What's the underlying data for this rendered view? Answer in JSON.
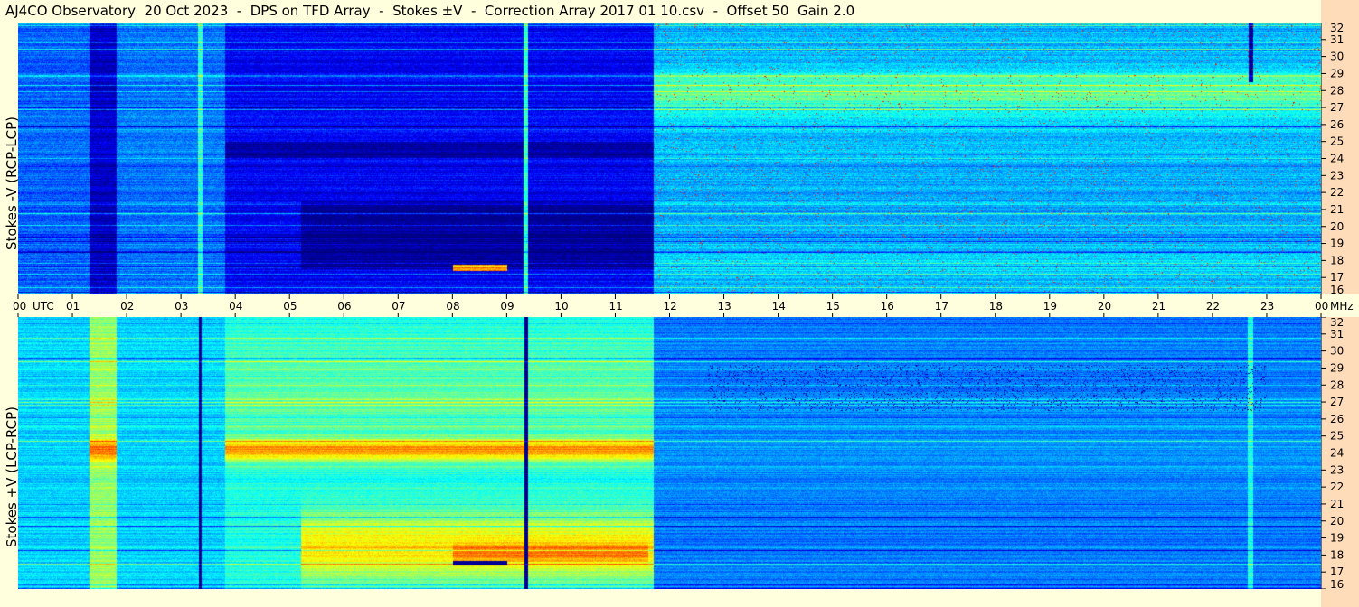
{
  "title": "AJ4CO Observatory  20 Oct 2023  -  DPS on TFD Array  -  Stokes ±V  -  Correction Array 2017 01 10.csv  -  Offset 50  Gain 2.0",
  "chart_data": [
    {
      "type": "heatmap",
      "panel": "top",
      "ylabel": "Stokes -V (RCP-LCP)",
      "xlabel": "UTC",
      "x_ticks": [
        "00",
        "01",
        "02",
        "03",
        "04",
        "05",
        "06",
        "07",
        "08",
        "09",
        "10",
        "11",
        "12",
        "13",
        "14",
        "15",
        "16",
        "17",
        "18",
        "19",
        "20",
        "21",
        "22",
        "23",
        "00"
      ],
      "y_unit": "MHz",
      "y_ticks": [
        16,
        17,
        18,
        19,
        20,
        21,
        22,
        23,
        24,
        25,
        26,
        27,
        28,
        29,
        30,
        31,
        32
      ],
      "xlim_hours": [
        0,
        24
      ],
      "ylim_mhz": [
        16,
        32
      ],
      "colormap": "jet",
      "features": [
        {
          "desc": "low-intensity dark band",
          "start_hour": 1.3,
          "end_hour": 1.8
        },
        {
          "desc": "low-intensity dark band",
          "start_hour": 3.8,
          "end_hour": 11.7
        },
        {
          "desc": "narrow vertical spike",
          "hour": 3.35
        },
        {
          "desc": "narrow vertical spike",
          "hour": 9.35
        },
        {
          "desc": "elevated activity 27-29 MHz",
          "start_hour": 12.7,
          "end_hour": 23.0
        },
        {
          "desc": "narrow dark vertical line",
          "hour": 22.7
        }
      ]
    },
    {
      "type": "heatmap",
      "panel": "bottom",
      "ylabel": "Stokes +V (LCP-RCP)",
      "xlabel": "UTC",
      "y_unit": "MHz",
      "y_ticks": [
        16,
        17,
        18,
        19,
        20,
        21,
        22,
        23,
        24,
        25,
        26,
        27,
        28,
        29,
        30,
        31,
        32
      ],
      "xlim_hours": [
        0,
        24
      ],
      "ylim_mhz": [
        16,
        32
      ],
      "colormap": "jet",
      "features": [
        {
          "desc": "bright band centered 24.3 MHz",
          "start_hour": 1.3,
          "end_hour": 1.8
        },
        {
          "desc": "bright band centered 24.3 MHz",
          "start_hour": 3.8,
          "end_hour": 11.7
        },
        {
          "desc": "bright band centered 18 MHz",
          "start_hour": 5.2,
          "end_hour": 11.7
        },
        {
          "desc": "dark vertical line",
          "hour": 3.35
        },
        {
          "desc": "dark vertical line",
          "hour": 9.35
        },
        {
          "desc": "dark speckle 27-29 MHz",
          "start_hour": 12.7,
          "end_hour": 23.0
        }
      ]
    }
  ],
  "utc_axis": {
    "labels": [
      "00",
      "01",
      "02",
      "03",
      "04",
      "05",
      "06",
      "07",
      "08",
      "09",
      "10",
      "11",
      "12",
      "13",
      "14",
      "15",
      "16",
      "17",
      "18",
      "19",
      "20",
      "21",
      "22",
      "23",
      "00"
    ],
    "utc_label": "UTC",
    "mhz_label": "MHz"
  }
}
